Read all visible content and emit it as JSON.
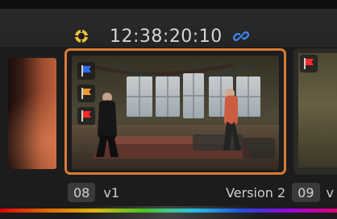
{
  "header": {
    "timecode": "12:38:20:10",
    "icons": {
      "target": "target-icon",
      "link": "link-icon"
    }
  },
  "clips": [
    {
      "number": "08",
      "version_short": "v1",
      "version_name": "Version 2",
      "selected": true,
      "flags": [
        "blue-flag-icon",
        "orange-flag-icon",
        "red-flag-icon"
      ]
    },
    {
      "number": "09",
      "version_short": "v",
      "flags": [
        "red-flag-icon"
      ]
    }
  ],
  "colors": {
    "selection": "#d77b35",
    "blue_flag": "#2d6cff",
    "orange_flag": "#f09a2e",
    "red_flag": "#ff2a2a",
    "link_icon": "#3b8cff",
    "target_icon": "#f2c13a"
  }
}
